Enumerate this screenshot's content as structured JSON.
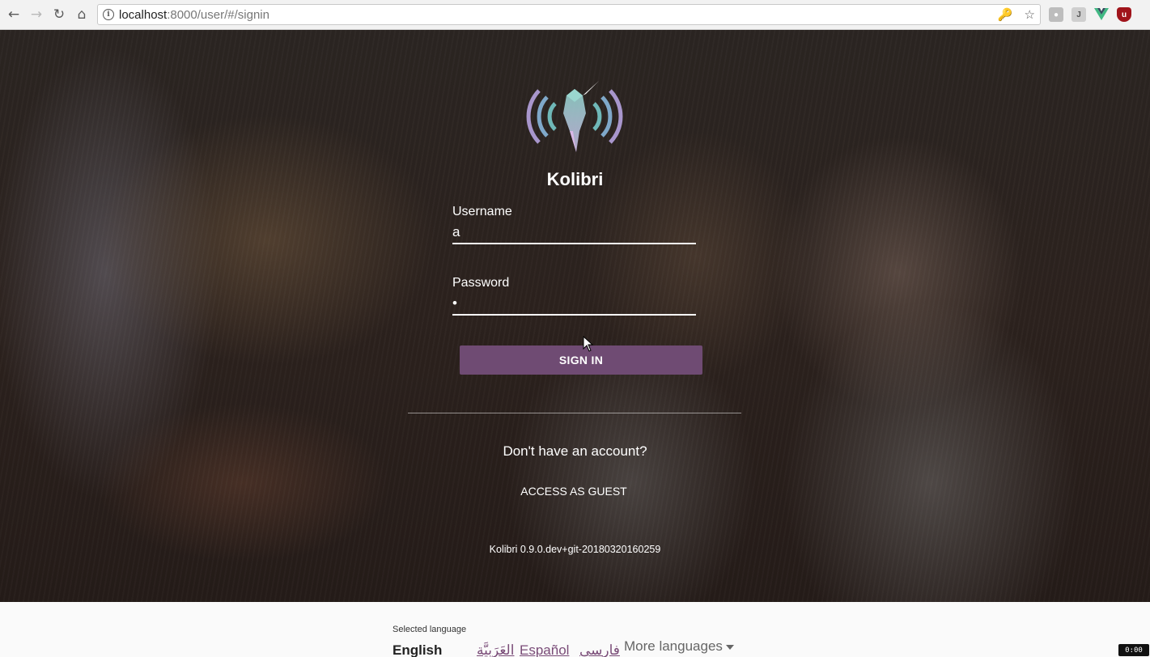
{
  "browser": {
    "url_host": "localhost",
    "url_rest": ":8000/user/#/signin",
    "icons": [
      "back-icon",
      "forward-icon",
      "reload-icon",
      "home-icon",
      "info-icon",
      "key-icon",
      "star-icon"
    ],
    "extensions": [
      "bug-extension-icon",
      "j-extension-icon",
      "vue-extension-icon",
      "ublock-extension-icon"
    ]
  },
  "signin": {
    "brand_name": "Kolibri",
    "username_label": "Username",
    "username_value": "a",
    "password_label": "Password",
    "password_value": "•",
    "signin_button": "SIGN IN",
    "no_account_text": "Don't have an account?",
    "guest_link": "ACCESS AS GUEST",
    "version": "Kolibri 0.9.0.dev+git-20180320160259"
  },
  "language": {
    "selected_label": "Selected language",
    "current": "English",
    "options": [
      "العَرَبِيَّة",
      "Español",
      "فارسی"
    ],
    "more_label": "More languages"
  },
  "corner_badge": "0:00",
  "colors": {
    "accent": "#6f4b73",
    "link": "#7a4c78"
  }
}
